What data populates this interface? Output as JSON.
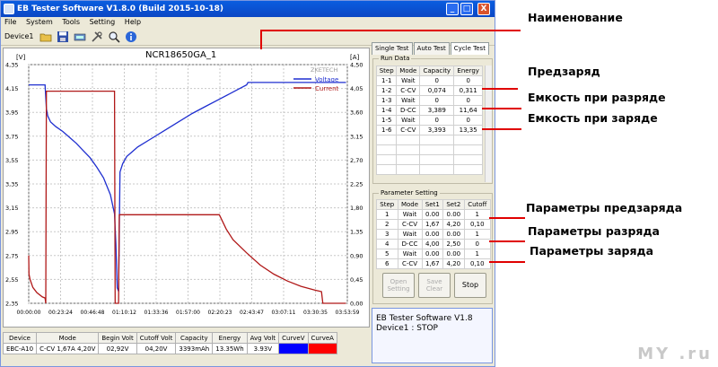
{
  "window": {
    "title": "EB Tester Software V1.8.0 (Build 2015-10-18)",
    "controls": [
      "_",
      "□",
      "X"
    ]
  },
  "menu": [
    "File",
    "System",
    "Tools",
    "Setting",
    "Help"
  ],
  "toolbar": {
    "device_label": "Device1",
    "icons": [
      "folder-icon",
      "save-icon",
      "meter-icon",
      "tools-icon",
      "search-icon",
      "info-icon"
    ]
  },
  "chart_data": {
    "type": "line",
    "title": "NCR18650GA_1",
    "watermark": "ZKETECH",
    "left_axis_unit": "[V]",
    "right_axis_unit": "[A]",
    "left_ticks": [
      "4,35",
      "4,15",
      "3,95",
      "3,75",
      "3,55",
      "3,35",
      "3,15",
      "2,95",
      "2,75",
      "2,55",
      "2,35"
    ],
    "right_ticks": [
      "4,50",
      "4,05",
      "3,60",
      "3,15",
      "2,70",
      "2,25",
      "1,80",
      "1,35",
      "0,90",
      "0,45",
      "0,00"
    ],
    "x_ticks": [
      "00:00:00",
      "00:23:24",
      "00:46:48",
      "01:10:12",
      "01:33:36",
      "01:57:00",
      "02:20:23",
      "02:43:47",
      "03:07:11",
      "03:30:35",
      "03:53:59"
    ],
    "ylim_left": [
      2.35,
      4.35
    ],
    "ylim_right": [
      0,
      4.5
    ],
    "xlim_minutes": [
      0,
      233.98
    ],
    "legend_position": "top-right",
    "series": [
      {
        "name": "Voltage",
        "axis": "left",
        "color": "#1f2fd0",
        "x": [
          0,
          1,
          12,
          13,
          14,
          16,
          20,
          25,
          30,
          35,
          40,
          45,
          50,
          55,
          60,
          63,
          64,
          65,
          66,
          67,
          69,
          72,
          76,
          80,
          90,
          100,
          110,
          120,
          130,
          140,
          150,
          155,
          160,
          161,
          165,
          170,
          200,
          233
        ],
        "y": [
          4.18,
          4.18,
          4.18,
          3.98,
          3.92,
          3.87,
          3.83,
          3.79,
          3.74,
          3.69,
          3.63,
          3.57,
          3.49,
          3.4,
          3.26,
          3.1,
          2.85,
          2.48,
          2.45,
          3.45,
          3.52,
          3.58,
          3.62,
          3.66,
          3.73,
          3.8,
          3.87,
          3.94,
          4.0,
          4.06,
          4.12,
          4.15,
          4.18,
          4.2,
          4.2,
          4.2,
          4.2,
          4.2
        ]
      },
      {
        "name": "Current",
        "axis": "right",
        "color": "#b01818",
        "x": [
          0,
          0.2,
          1,
          3,
          6,
          10,
          12,
          12.5,
          13,
          63,
          63.5,
          64,
          66,
          66.5,
          140,
          145,
          150,
          160,
          170,
          180,
          190,
          200,
          210,
          215,
          216,
          233
        ],
        "y": [
          0.9,
          0.55,
          0.45,
          0.3,
          0.2,
          0.12,
          0.1,
          0.0,
          4.0,
          4.0,
          0.0,
          0.0,
          0.0,
          1.67,
          1.67,
          1.4,
          1.2,
          0.95,
          0.72,
          0.55,
          0.42,
          0.32,
          0.25,
          0.22,
          0.0,
          0.0
        ]
      }
    ]
  },
  "right_panel": {
    "tabs": [
      "Single Test",
      "Auto Test",
      "Cycle Test"
    ],
    "active_tab": "Cycle Test",
    "run_data": {
      "label": "Run Data",
      "headers": [
        "Step",
        "Mode",
        "Capacity",
        "Energy"
      ],
      "rows": [
        [
          "1-1",
          "Wait",
          "0",
          "0"
        ],
        [
          "1-2",
          "C-CV",
          "0,074",
          "0,311"
        ],
        [
          "1-3",
          "Wait",
          "0",
          "0"
        ],
        [
          "1-4",
          "D-CC",
          "3,389",
          "11,64"
        ],
        [
          "1-5",
          "Wait",
          "0",
          "0"
        ],
        [
          "1-6",
          "C-CV",
          "3,393",
          "13,35"
        ]
      ]
    },
    "parameter_setting": {
      "label": "Parameter Setting",
      "headers": [
        "Step",
        "Mode",
        "Set1",
        "Set2",
        "Cutoff"
      ],
      "rows": [
        [
          "1",
          "Wait",
          "0.00",
          "0.00",
          "1"
        ],
        [
          "2",
          "C-CV",
          "1,67",
          "4,20",
          "0,10"
        ],
        [
          "3",
          "Wait",
          "0.00",
          "0.00",
          "1"
        ],
        [
          "4",
          "D-CC",
          "4,00",
          "2,50",
          "0"
        ],
        [
          "5",
          "Wait",
          "0.00",
          "0.00",
          "1"
        ],
        [
          "6",
          "C-CV",
          "1,67",
          "4,20",
          "0,10"
        ]
      ]
    },
    "buttons": {
      "open": "Open",
      "save": "Save",
      "setting": "Setting",
      "clear": "Clear",
      "stop": "Stop"
    },
    "log": {
      "line1": "EB Tester Software V1.8",
      "line2": "Device1 : STOP"
    }
  },
  "status_table": {
    "headers": [
      "Device",
      "Mode",
      "Begin Volt",
      "Cutoff Volt",
      "Capacity",
      "Energy",
      "Avg Volt",
      "CurveV",
      "CurveA"
    ],
    "row": [
      "EBC-A10",
      "C-CV 1,67A 4,20V",
      "02,92V",
      "04,20V",
      "3393mAh",
      "13.35Wh",
      "3.93V",
      "",
      ""
    ],
    "curve_colors": [
      "#0000ff",
      "#ff0000"
    ]
  },
  "annotations": {
    "name": "Наименование",
    "precharge": "Предзаряд",
    "discharge_capacity": "Емкость при разряде",
    "charge_capacity": "Емкость при заряде",
    "precharge_params": "Параметры предзаряда",
    "discharge_params": "Параметры разряда",
    "charge_params": "Параметры заряда"
  },
  "watermark": "MY .ru"
}
